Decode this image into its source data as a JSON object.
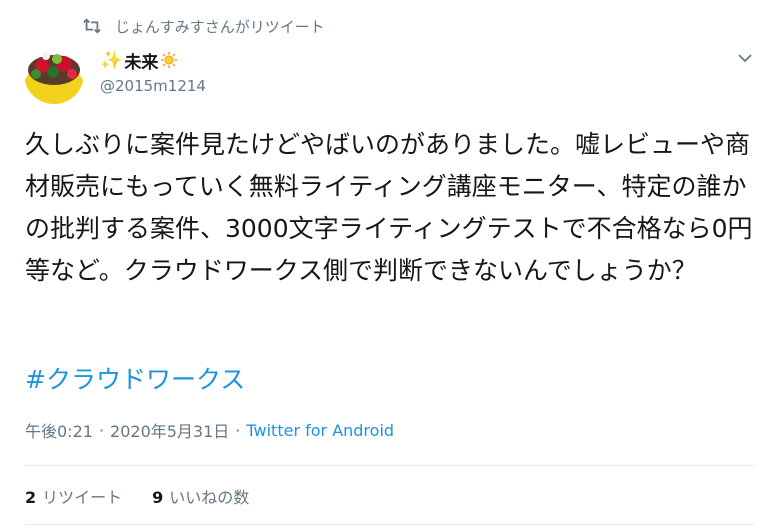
{
  "retweet": {
    "text": "じょんすみすさんがリツイート",
    "icon": "retweet-icon"
  },
  "author": {
    "emoji": "✨",
    "name": "未来",
    "sun_icon": "sun-icon",
    "handle": "@2015m1214",
    "avatar": "avatar"
  },
  "menu_icon": "chevron-down-icon",
  "tweet": {
    "text": "久しぶりに案件見たけどやばいのがありました。嘘レビューや商材販売にもっていく無料ライティング講座モニター、特定の誰かの批判する案件、3000文字ライティングテストで不合格なら0円等など。クラウドワークス側で判断できないんでしょうか？",
    "hashtag": "#クラウドワークス"
  },
  "meta": {
    "time": "午後0:21",
    "separator": "·",
    "date": "2020年5月31日",
    "source": "Twitter for Android"
  },
  "stats": {
    "retweets_count": "2",
    "retweets_label": "リツイート",
    "likes_count": "9",
    "likes_label": "いいねの数"
  },
  "colors": {
    "link": "#1b95e0",
    "muted": "#657786",
    "text": "#14171a",
    "divider": "#e6ecf0"
  }
}
